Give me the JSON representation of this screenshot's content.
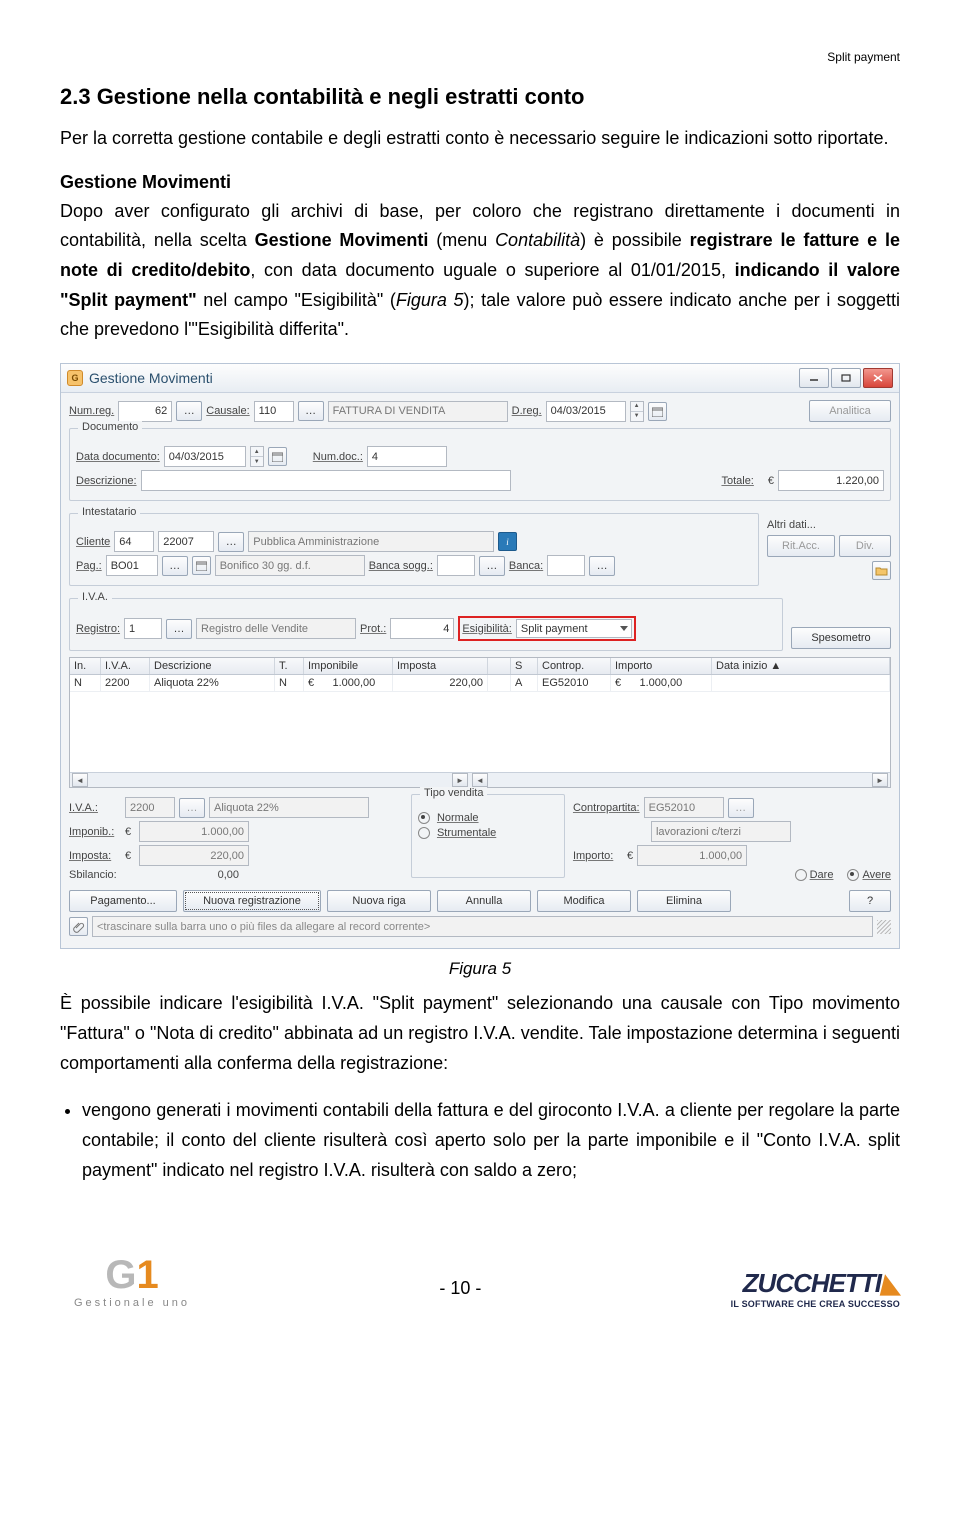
{
  "header": {
    "right": "Split payment"
  },
  "section": {
    "title": "2.3  Gestione nella contabilità e negli estratti conto",
    "intro": "Per la corretta gestione contabile e degli estratti conto è necessario seguire le indicazioni sotto riportate.",
    "sub_heading": "Gestione Movimenti",
    "para2_a": "Dopo aver configurato gli archivi di base, per coloro che registrano direttamente i documenti in contabilità, nella scelta ",
    "para2_b": "Gestione Movimenti",
    "para2_c": " (menu ",
    "para2_d": "Contabilità",
    "para2_e": ") è possibile ",
    "para2_f": "registrare le fatture e le note di credito/debito",
    "para2_g": ", con data documento uguale o superiore al 01/01/2015, ",
    "para2_h": "indicando il valore \"Split payment\"",
    "para2_i": " nel campo \"Esigibilità\" (",
    "para2_j": "Figura 5",
    "para2_k": "); tale valore può essere indicato anche per i soggetti che prevedono l'\"Esigibilità differita\".",
    "caption": "Figura 5",
    "para3_a": "È possibile indicare l'esigibilità I.V.A. \"Split payment\" selezionando una causale con Tipo movimento \"Fattura\" o \"Nota di credito\" abbinata ad un registro I.V.A. vendite. Tale impostazione determina i seguenti comportamenti alla conferma della registrazione:",
    "bullet1_a": "vengono generati i movimenti contabili della ",
    "bullet1_b": "fattura",
    "bullet1_c": " e del ",
    "bullet1_d": "giroconto I.V.A. a cliente",
    "bullet1_e": " per regolare la parte contabile; il conto del cliente risulterà così aperto solo per la parte imponibile e il \"Conto I.V.A. split payment\" indicato nel registro I.V.A. risulterà con saldo a zero;"
  },
  "app": {
    "title": "Gestione Movimenti",
    "numreg_lbl": "Num.reg.",
    "numreg": "62",
    "causale_lbl": "Causale:",
    "causale_code": "110",
    "causale_desc": "FATTURA DI VENDITA",
    "dreg_lbl": "D.reg.",
    "dreg": "04/03/2015",
    "analitica": "Analitica",
    "grp_doc": "Documento",
    "data_doc_lbl": "Data documento:",
    "data_doc": "04/03/2015",
    "numdoc_lbl": "Num.doc.:",
    "numdoc": "4",
    "descr_lbl": "Descrizione:",
    "totale_lbl": "Totale:",
    "totale_cur": "€",
    "totale": "1.220,00",
    "grp_int": "Intestatario",
    "cliente_lbl": "Cliente",
    "cliente_code": "64",
    "cliente_sub": "22007",
    "cliente_desc": "Pubblica Amministrazione",
    "altri_dati": "Altri dati...",
    "ritacc": "Rit.Acc.",
    "div": "Div.",
    "pag_lbl": "Pag.:",
    "pag_code": "BO01",
    "pag_desc": "Bonifico 30 gg. d.f.",
    "banca_sogg_lbl": "Banca sogg.:",
    "banca_lbl": "Banca:",
    "grp_iva": "I.V.A.",
    "registro_lbl": "Registro:",
    "registro_code": "1",
    "registro_desc": "Registro delle Vendite",
    "prot_lbl": "Prot.:",
    "prot": "4",
    "esig_lbl": "Esigibilità:",
    "esig_val": "Split payment",
    "spesometro": "Spesometro",
    "gh": {
      "in": "In.",
      "iva": "I.V.A.",
      "desc": "Descrizione",
      "t": "T.",
      "impon": "Imponibile",
      "imposta": "Imposta",
      "s": "S",
      "controp": "Controp.",
      "importo": "Importo",
      "datainiz": "Data inizio"
    },
    "row": {
      "in": "N",
      "iva": "2200",
      "desc": "Aliquota 22%",
      "t": "N",
      "cur": "€",
      "impon": "1.000,00",
      "imposta": "220,00",
      "s": "A",
      "controp": "EG52010",
      "impcur": "€",
      "importo": "1.000,00"
    },
    "lower": {
      "iva_lbl": "I.V.A.:",
      "iva_code": "2200",
      "iva_desc": "Aliquota 22%",
      "imponib_lbl": "Imponib.:",
      "imponib": "1.000,00",
      "imposta_lbl": "Imposta:",
      "imposta": "220,00",
      "sbilancio_lbl": "Sbilancio:",
      "sbilancio": "0,00",
      "tipovendita": "Tipo vendita",
      "normale": "Normale",
      "strumentale": "Strumentale",
      "contropartita_lbl": "Contropartita:",
      "controp": "EG52010",
      "controp_desc": "lavorazioni c/terzi",
      "importo_lbl": "Importo:",
      "importo": "1.000,00",
      "dare": "Dare",
      "avere": "Avere"
    },
    "buttons": {
      "pagamento": "Pagamento...",
      "nuova_reg": "Nuova registrazione",
      "nuova_riga": "Nuova riga",
      "annulla": "Annulla",
      "modifica": "Modifica",
      "elimina": "Elimina",
      "help": "?"
    },
    "dragbar": "<trascinare sulla barra uno o più files da allegare al record corrente>"
  },
  "footer": {
    "g1_mark_g": "G",
    "g1_mark_1": "1",
    "g1_sub": "Gestionale uno",
    "page": "- 10 -",
    "z_name": "ZUCCHETTI",
    "z_tag": "IL SOFTWARE CHE CREA SUCCESSO"
  }
}
